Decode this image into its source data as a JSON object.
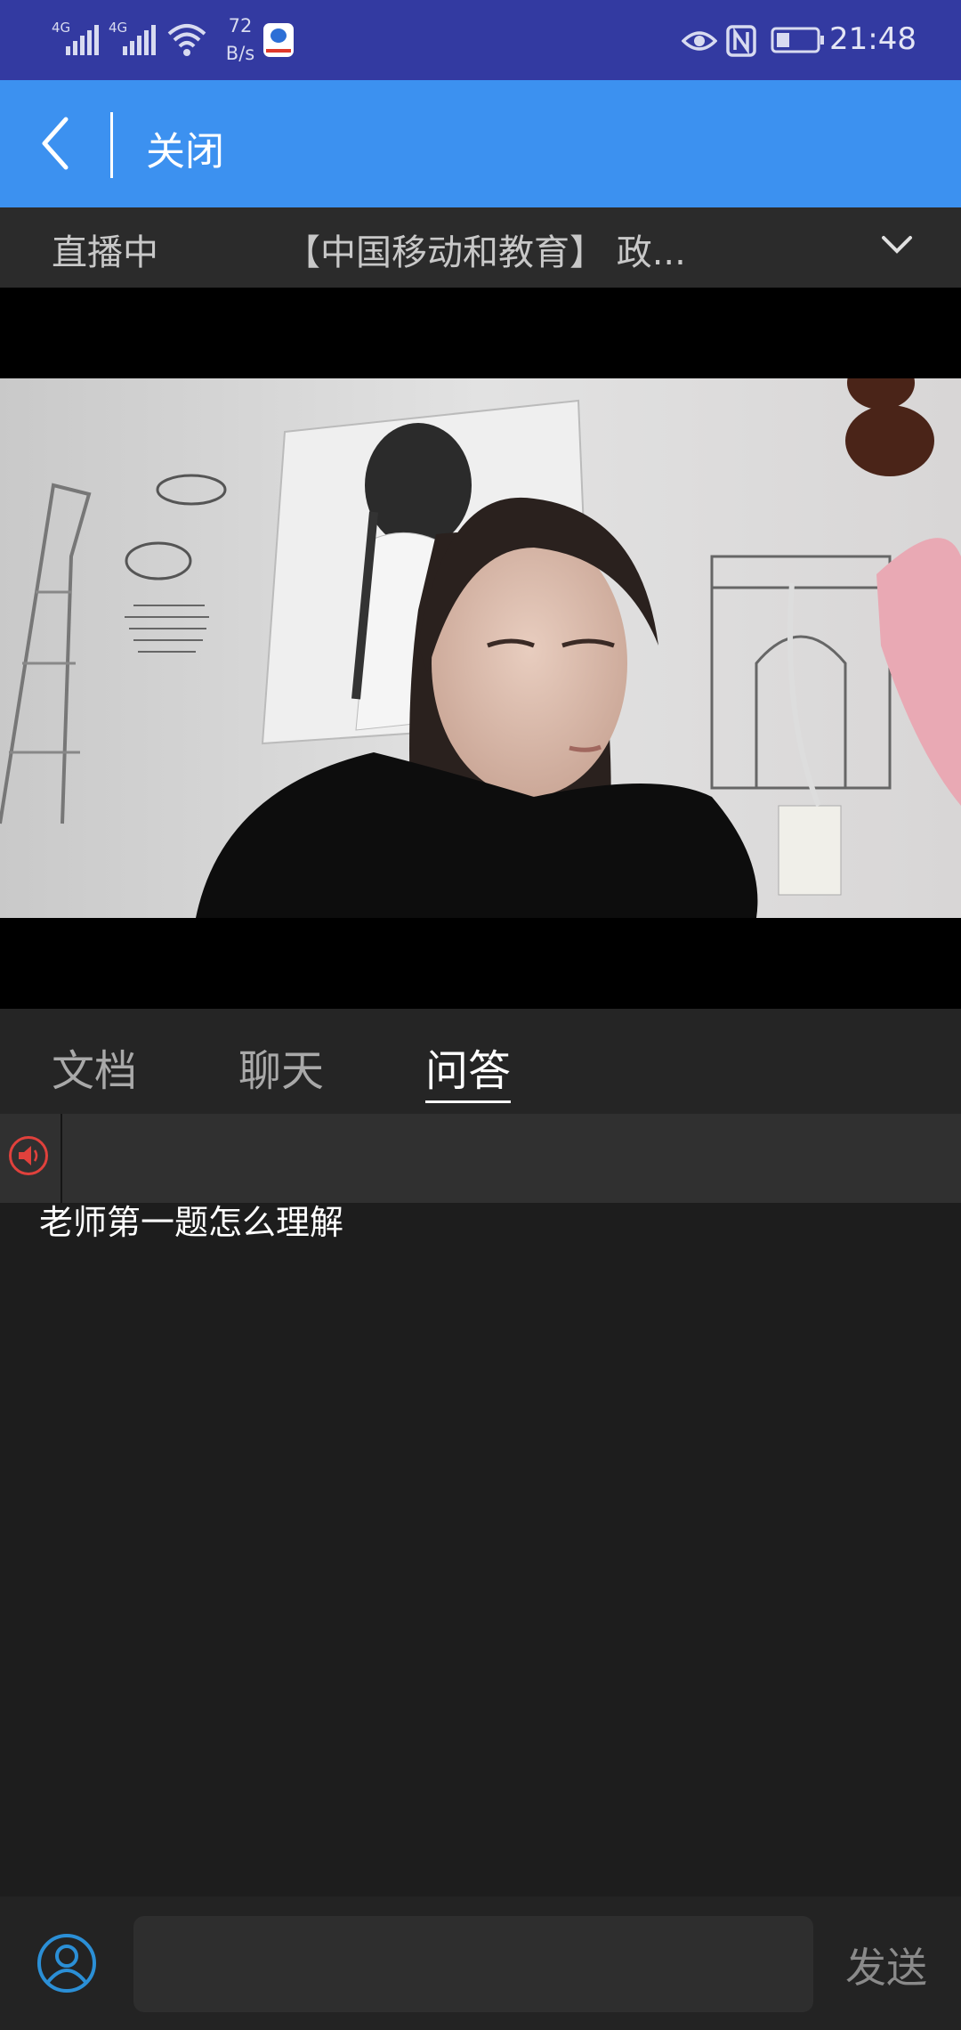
{
  "status_bar": {
    "signal1_label": "4G",
    "signal2_label": "4G",
    "net_speed_value": "72",
    "net_speed_unit": "B/s",
    "time": "21:48",
    "icons": [
      "signal-icon",
      "signal-icon",
      "wifi-icon",
      "baidu-app-icon",
      "eye-icon",
      "nfc-icon",
      "battery-icon"
    ]
  },
  "header": {
    "close_label": "关闭"
  },
  "live_bar": {
    "status": "直播中",
    "title": "【中国移动和教育】 政..."
  },
  "tabs": [
    {
      "label": "文档",
      "active": false
    },
    {
      "label": "聊天",
      "active": false
    },
    {
      "label": "问答",
      "active": true
    }
  ],
  "qa": {
    "question": "老师第一题怎么理解"
  },
  "bottom": {
    "input_placeholder": "",
    "send_label": "发送"
  },
  "colors": {
    "status_bar": "#333aa1",
    "header": "#3c91f0",
    "background": "#1d1d1d",
    "speaker": "#e0413c",
    "avatar": "#2b8fd6"
  }
}
